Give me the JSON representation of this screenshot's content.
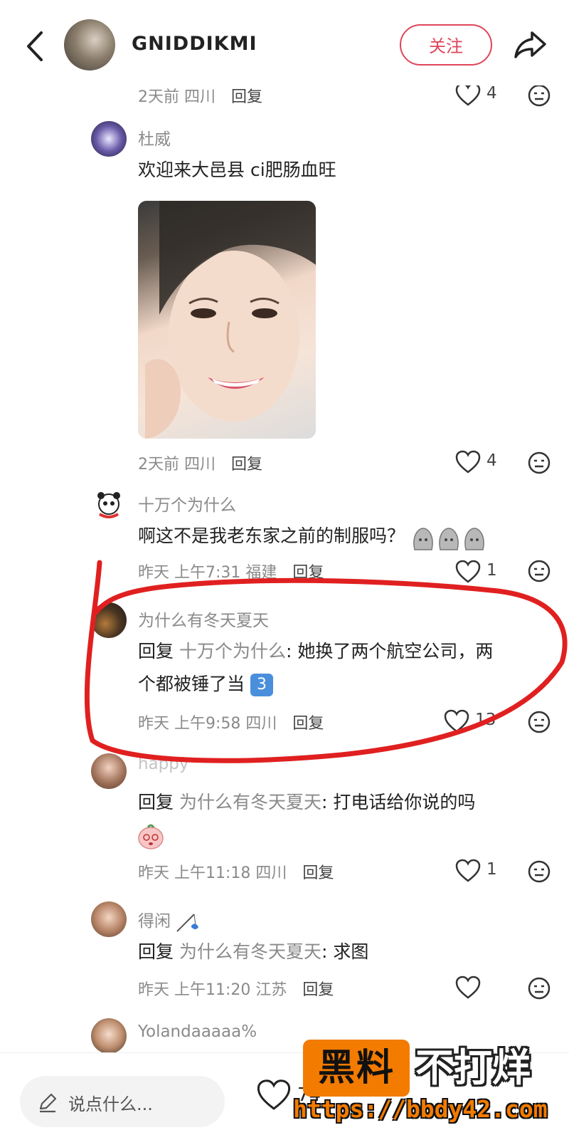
{
  "header": {
    "username": "GNIDDIKMI",
    "follow_label": "关注"
  },
  "comments": [
    {
      "time": "2天前 四川",
      "reply_label": "回复",
      "likes": "4"
    },
    {
      "author": "杜威",
      "text": "欢迎来大邑县 ci肥肠血旺",
      "time": "2天前 四川",
      "reply_label": "回复",
      "likes": "4"
    },
    {
      "author": "十万个为什么",
      "text": "啊这不是我老东家之前的制服吗？",
      "time": "昨天 上午7:31 福建",
      "reply_label": "回复",
      "likes": "1"
    },
    {
      "author": "为什么有冬天夏天",
      "reply_prefix": "回复",
      "reply_to": "十万个为什么",
      "text_line1": ": 她换了两个航空公司，两",
      "text_line2": "个都被锤了当",
      "emoji_badge": "3",
      "time": "昨天 上午9:58 四川",
      "reply_label": "回复",
      "likes": "13"
    },
    {
      "author": "happy",
      "reply_prefix": "回复",
      "reply_to": "为什么有冬天夏天",
      "text": ": 打电话给你说的吗",
      "time": "昨天 上午11:18 四川",
      "reply_label": "回复",
      "likes": "1"
    },
    {
      "author": "得闲",
      "reply_prefix": "回复",
      "reply_to": "为什么有冬天夏天",
      "text": ": 求图",
      "time": "昨天 上午11:20 江苏",
      "reply_label": "回复",
      "likes": ""
    },
    {
      "author": "Yolandaaaaa%"
    }
  ],
  "bottom": {
    "input_placeholder": "说点什么...",
    "like_count": "74"
  },
  "watermark": {
    "badge": "黑料",
    "slogan": "不打烊",
    "url": "https://bbdy42.com"
  },
  "colors": {
    "accent": "#e0455a",
    "annotation": "#e02020",
    "watermark": "#f37b00"
  },
  "icons": [
    "back-icon",
    "share-icon",
    "heart-icon",
    "emoji-face-icon",
    "pencil-icon"
  ]
}
